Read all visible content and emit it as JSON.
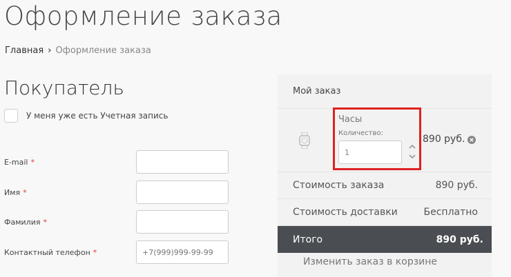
{
  "page": {
    "title": "Оформление заказа"
  },
  "breadcrumb": {
    "home": "Главная",
    "separator": "›",
    "current": "Оформление заказа"
  },
  "buyer": {
    "section_title": "Покупатель",
    "has_account_label": "У меня уже есть Учетная запись",
    "required_mark": "*",
    "fields": [
      {
        "label": "E-mail",
        "value": "",
        "placeholder": ""
      },
      {
        "label": "Имя",
        "value": "",
        "placeholder": ""
      },
      {
        "label": "Фамилия",
        "value": "",
        "placeholder": ""
      },
      {
        "label": "Контактный телефон",
        "value": "",
        "placeholder": "+7(999)999-99-99"
      }
    ]
  },
  "order": {
    "header": "Мой заказ",
    "item": {
      "name": "Часы",
      "quantity_label": "Количество:",
      "quantity": "1",
      "price": "890 руб.",
      "icon": "watch-icon"
    },
    "order_cost_label": "Стоимость заказа",
    "order_cost_value": "890 руб.",
    "delivery_cost_label": "Стоимость доставки",
    "delivery_cost_value": "Бесплатно",
    "total_label": "Итого",
    "total_value": "890 руб.",
    "edit_link": "Изменить заказ в корзине"
  },
  "colors": {
    "highlight": "#e02020",
    "required": "#e0393e",
    "total_bg": "#4a4d52"
  }
}
